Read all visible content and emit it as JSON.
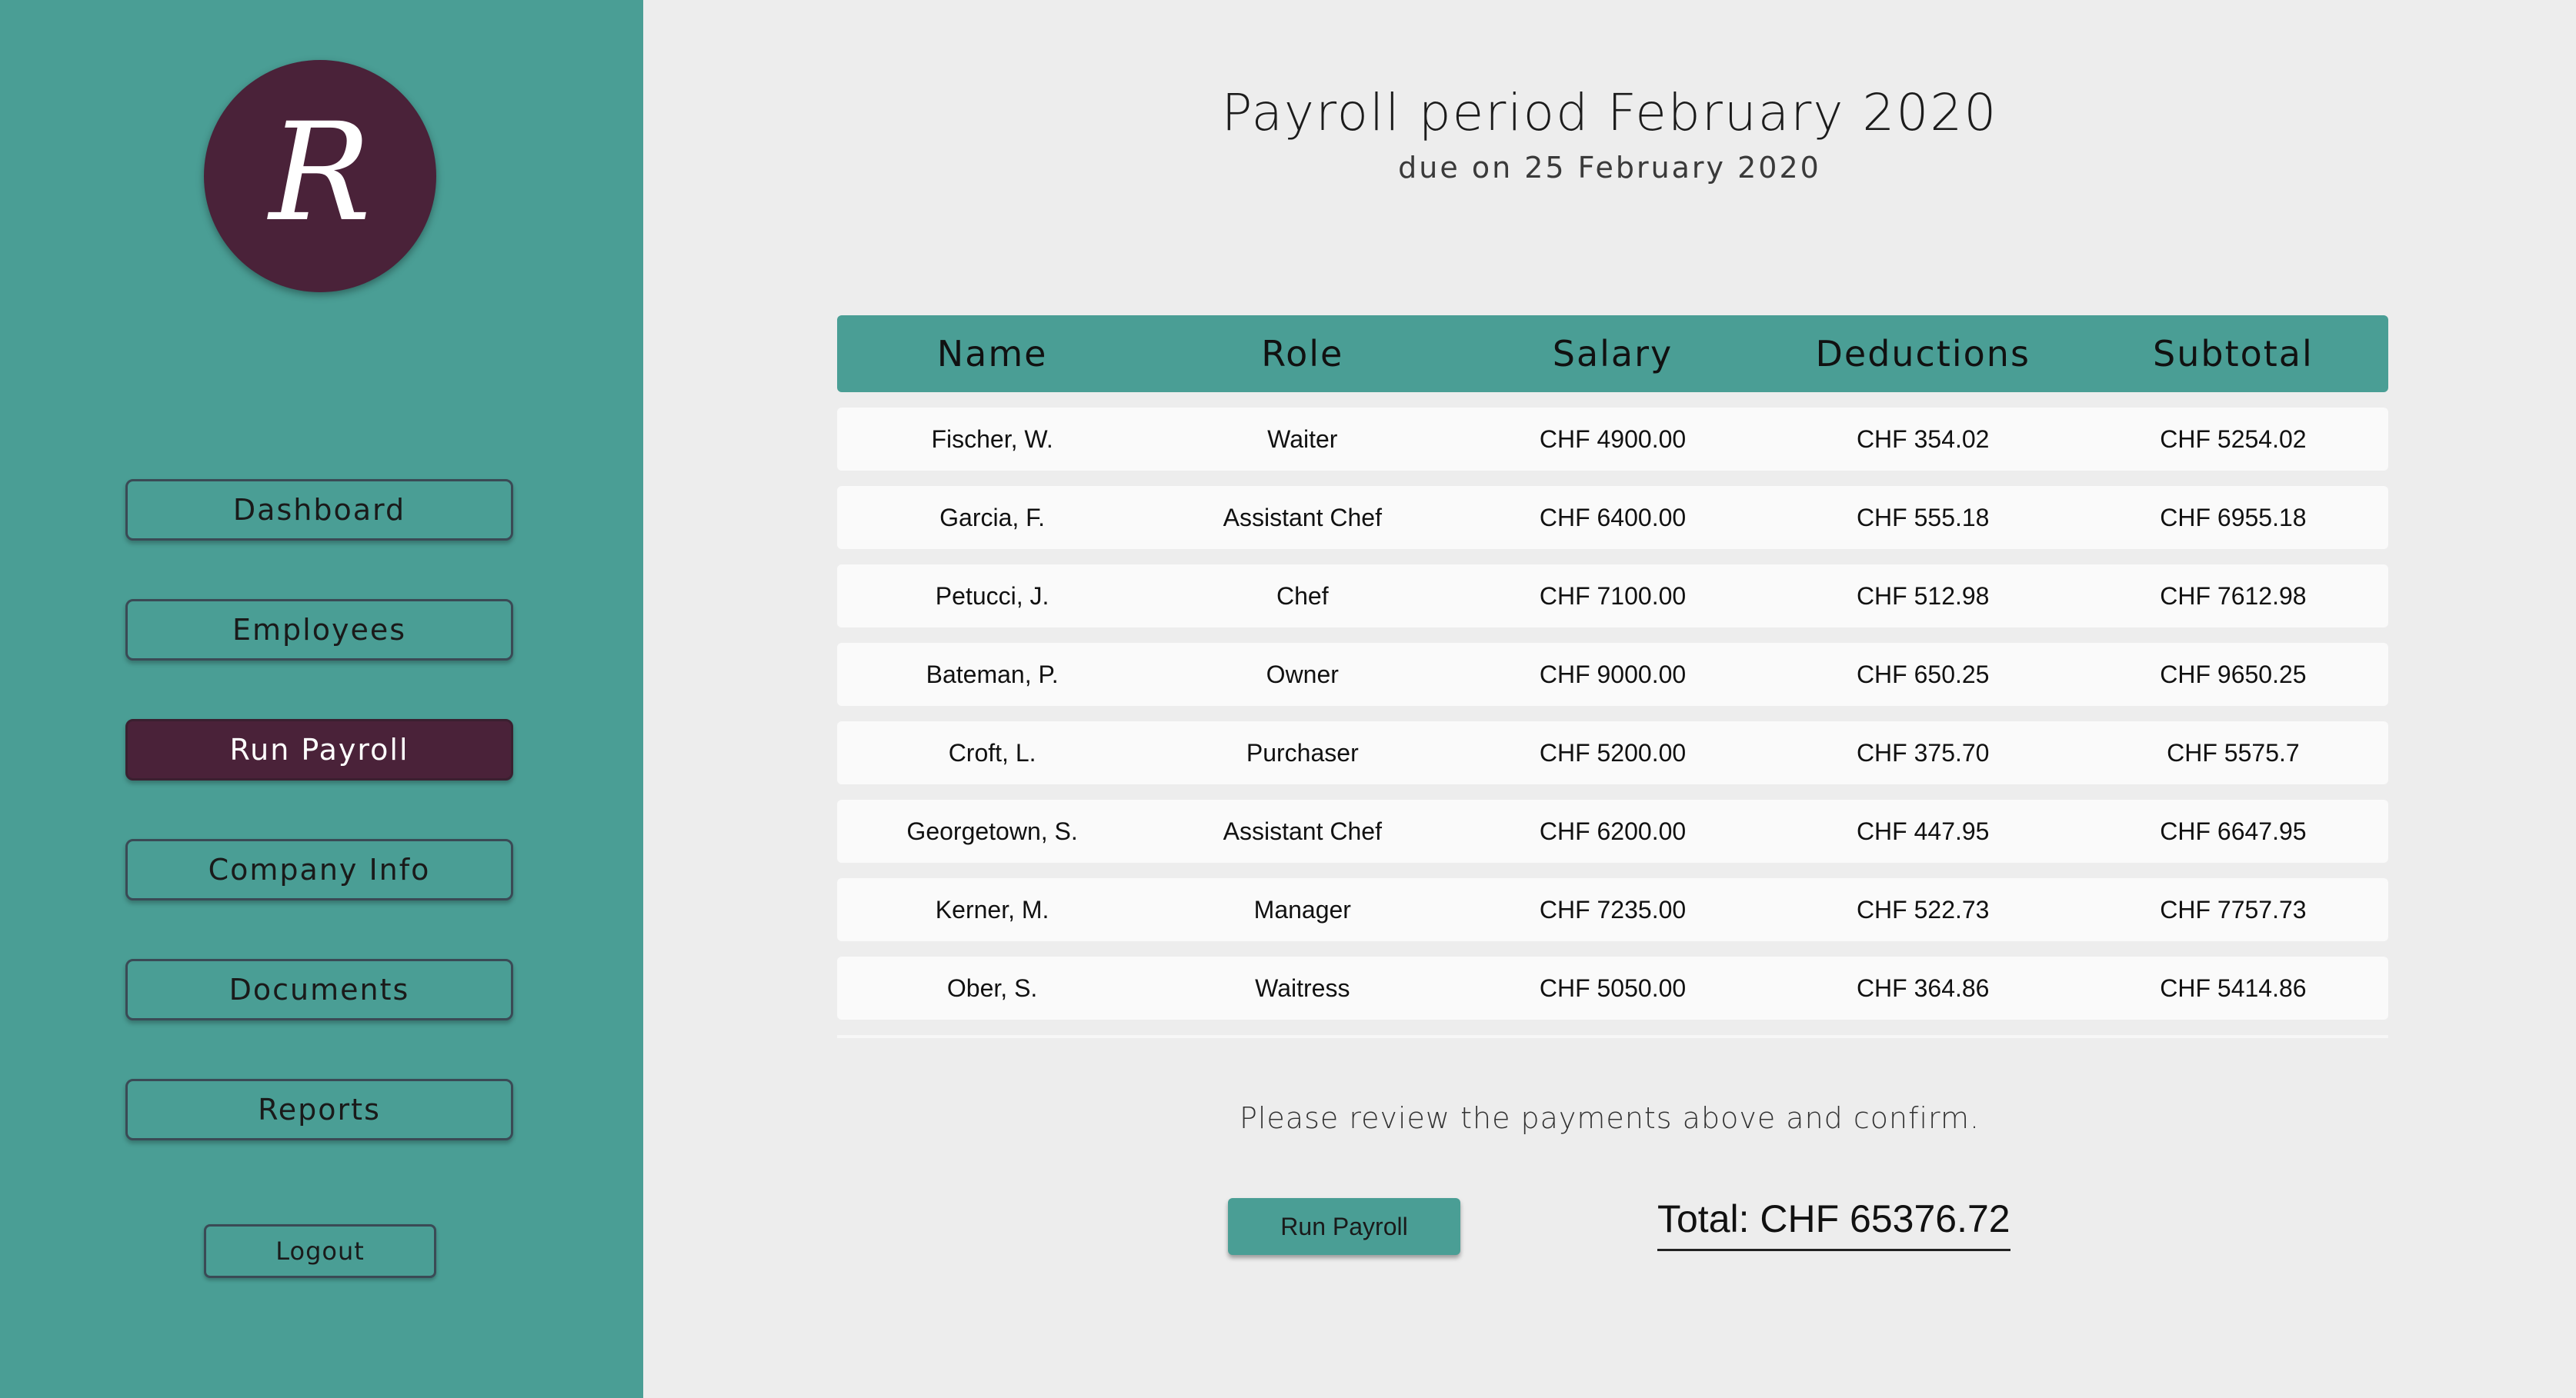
{
  "logo": {
    "letter": "R"
  },
  "sidebar": {
    "items": [
      {
        "label": "Dashboard",
        "active": false
      },
      {
        "label": "Employees",
        "active": false
      },
      {
        "label": "Run Payroll",
        "active": true
      },
      {
        "label": "Company Info",
        "active": false
      },
      {
        "label": "Documents",
        "active": false
      },
      {
        "label": "Reports",
        "active": false
      }
    ],
    "logout_label": "Logout"
  },
  "header": {
    "title": "Payroll period February 2020",
    "subtitle": "due on 25 February 2020"
  },
  "table": {
    "columns": [
      "Name",
      "Role",
      "Salary",
      "Deductions",
      "Subtotal"
    ],
    "rows": [
      [
        "Fischer, W.",
        "Waiter",
        "CHF 4900.00",
        "CHF 354.02",
        "CHF 5254.02"
      ],
      [
        "Garcia, F.",
        "Assistant Chef",
        "CHF 6400.00",
        "CHF 555.18",
        "CHF 6955.18"
      ],
      [
        "Petucci, J.",
        "Chef",
        "CHF 7100.00",
        "CHF 512.98",
        "CHF 7612.98"
      ],
      [
        "Bateman, P.",
        "Owner",
        "CHF 9000.00",
        "CHF 650.25",
        "CHF 9650.25"
      ],
      [
        "Croft, L.",
        "Purchaser",
        "CHF 5200.00",
        "CHF 375.70",
        "CHF 5575.7"
      ],
      [
        "Georgetown, S.",
        "Assistant Chef",
        "CHF 6200.00",
        "CHF 447.95",
        "CHF 6647.95"
      ],
      [
        "Kerner, M.",
        "Manager",
        "CHF 7235.00",
        "CHF 522.73",
        "CHF 7757.73"
      ],
      [
        "Ober, S.",
        "Waitress",
        "CHF 5050.00",
        "CHF 364.86",
        "CHF 5414.86"
      ]
    ]
  },
  "footer": {
    "review_text": "Please review the payments above and confirm.",
    "run_button_label": "Run Payroll",
    "total_text": "Total: CHF 65376.72"
  },
  "colors": {
    "teal": "#4a9e95",
    "plum": "#4a2239",
    "background": "#ededed"
  }
}
